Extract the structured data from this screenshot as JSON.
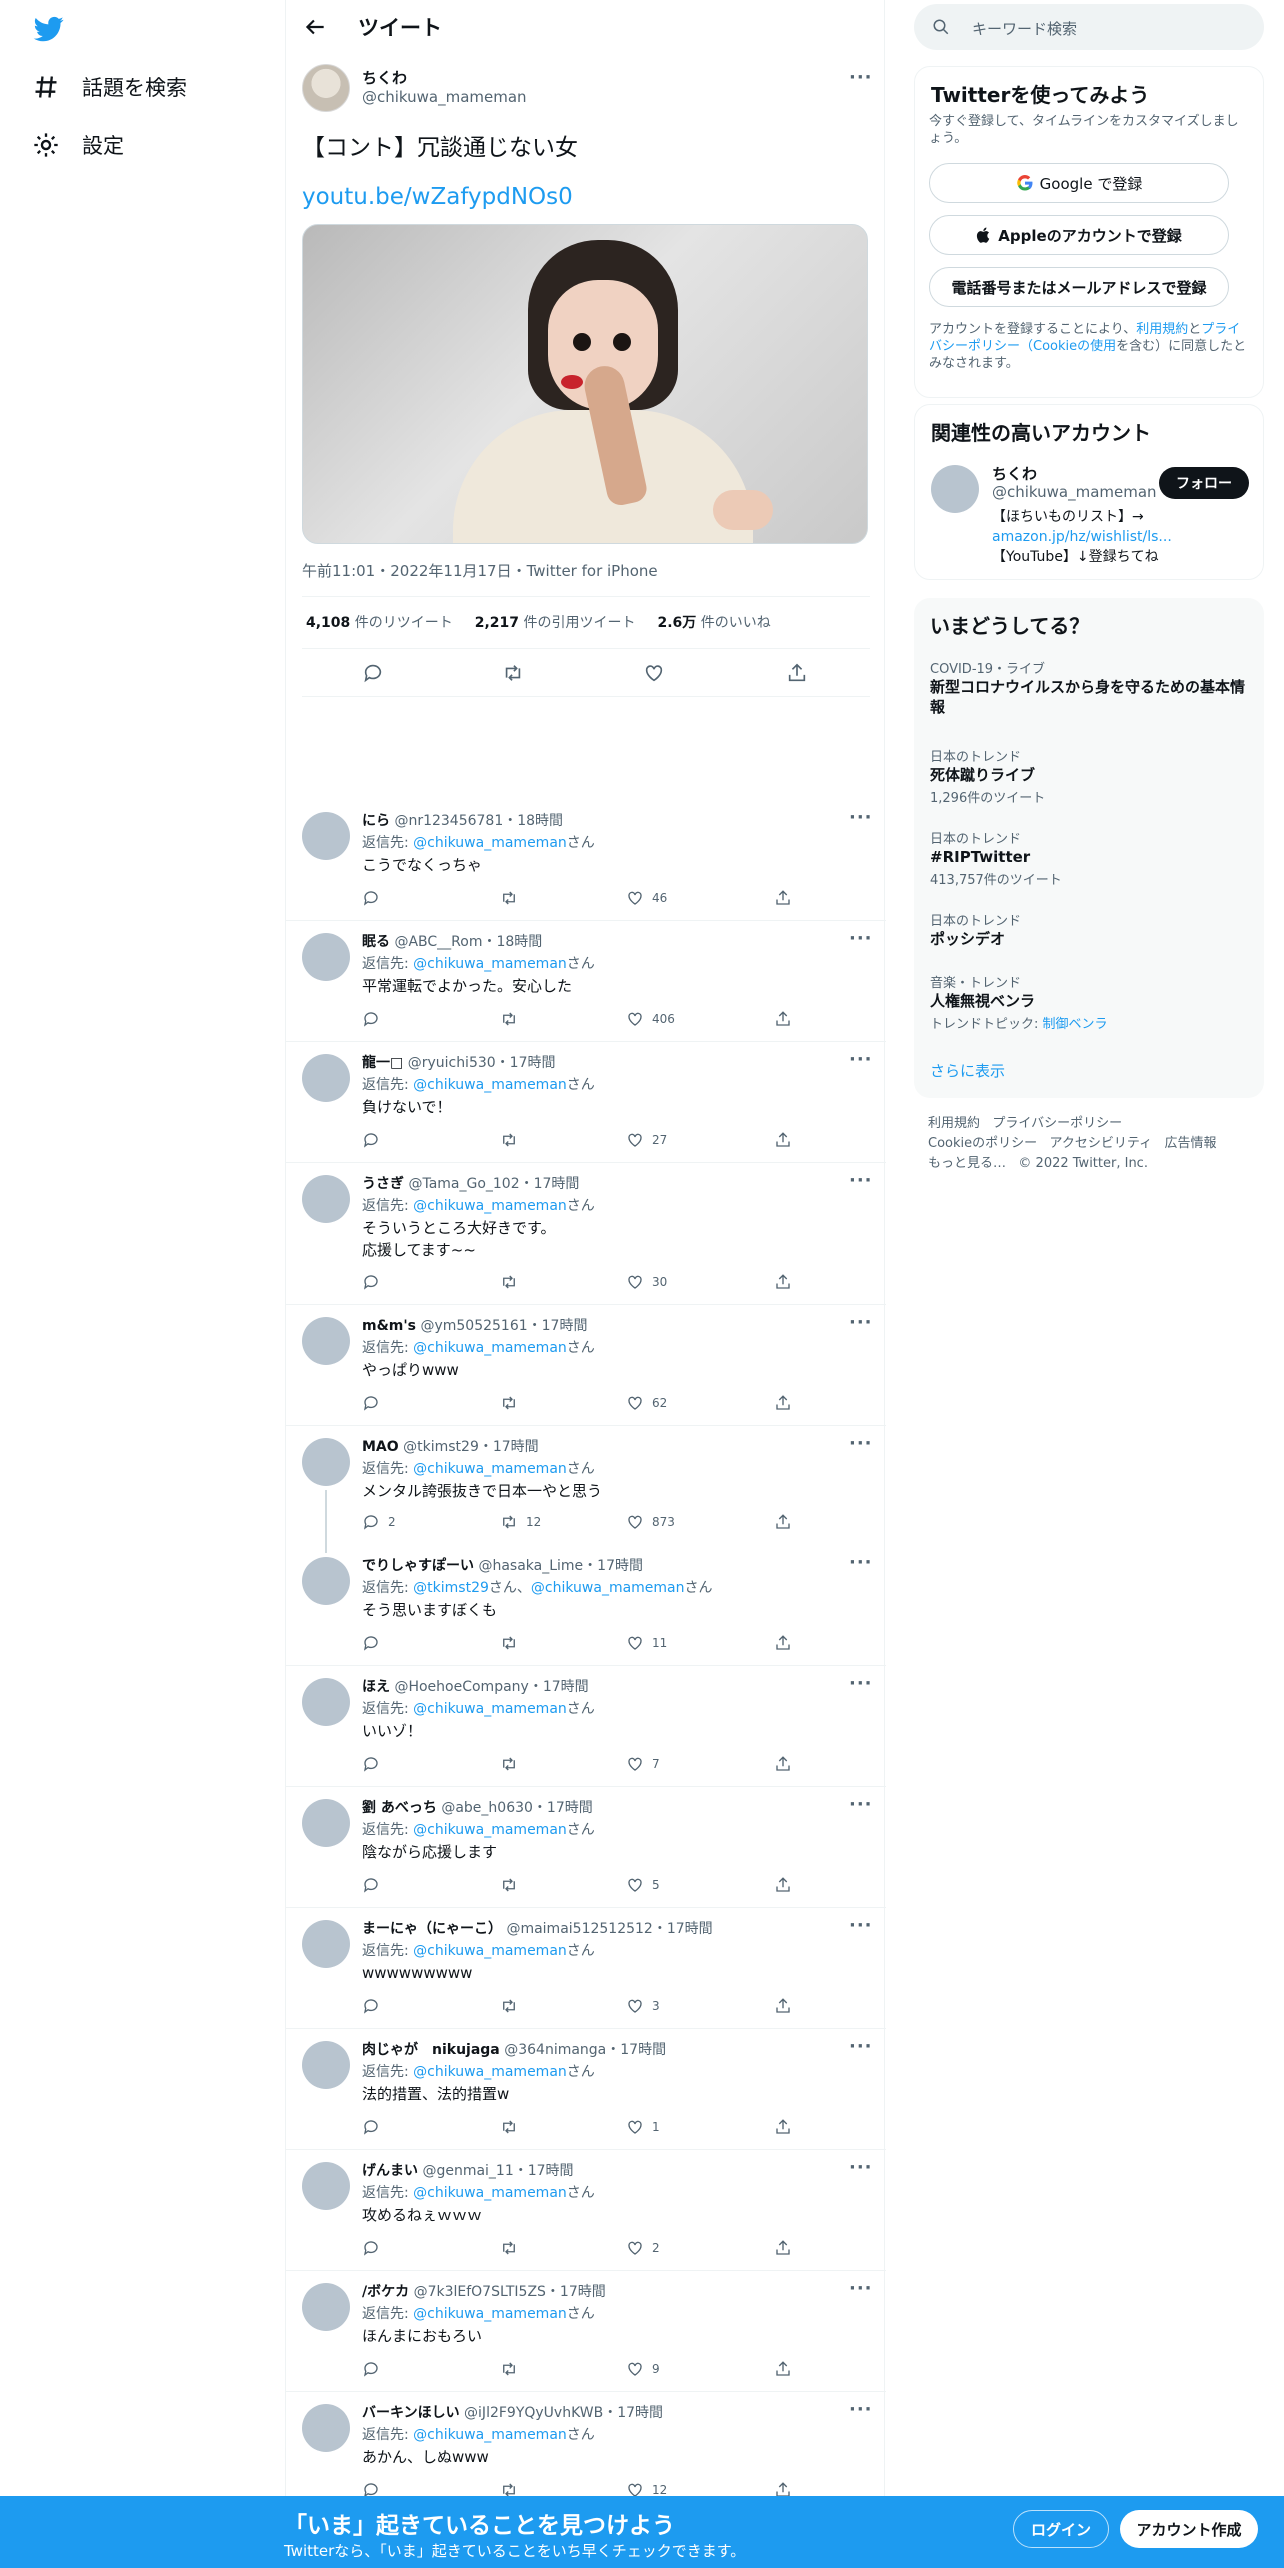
{
  "nav": {
    "explore_label": "話題を検索",
    "settings_label": "設定"
  },
  "header": {
    "title": "ツイート"
  },
  "tweet": {
    "name": "ちくわ",
    "handle": "@chikuwa_mameman",
    "text": "【コント】冗談通じない女",
    "link": "youtu.be/wZafypdNOs0",
    "meta": "午前11:01・2022年11月17日・Twitter for iPhone",
    "stats": {
      "retweets_num": "4,108",
      "retweets_label": "件のリツイート",
      "quotes_num": "2,217",
      "quotes_label": "件の引用ツイート",
      "likes_num": "2.6万",
      "likes_label": "件のいいね"
    }
  },
  "replies": [
    {
      "name": "にら",
      "meta": "@nr123456781・18時間",
      "rto_prefix": "返信先: ",
      "rto": "@chikuwa_mameman",
      "rto_suffix": "さん",
      "lines": [
        "こうでなくっちゃ"
      ],
      "replies": "",
      "retweets": "",
      "likes": "46"
    },
    {
      "name": "眠る",
      "meta": "@ABC__Rom・18時間",
      "rto_prefix": "返信先: ",
      "rto": "@chikuwa_mameman",
      "rto_suffix": "さん",
      "lines": [
        "平常運転でよかった。安心した"
      ],
      "replies": "",
      "retweets": "",
      "likes": "406"
    },
    {
      "name": "龍一□",
      "meta": "@ryuichi530・17時間",
      "rto_prefix": "返信先: ",
      "rto": "@chikuwa_mameman",
      "rto_suffix": "さん",
      "lines": [
        "負けないで！"
      ],
      "replies": "",
      "retweets": "",
      "likes": "27"
    },
    {
      "name": "うさぎ",
      "meta": "@Tama_Go_102・17時間",
      "rto_prefix": "返信先: ",
      "rto": "@chikuwa_mameman",
      "rto_suffix": "さん",
      "lines": [
        "そういうところ大好きです。",
        "応援してます~~"
      ],
      "replies": "",
      "retweets": "",
      "likes": "30"
    },
    {
      "name": "m&m's",
      "meta": "@ym50525161・17時間",
      "rto_prefix": "返信先: ",
      "rto": "@chikuwa_mameman",
      "rto_suffix": "さん",
      "lines": [
        "やっぱりwww"
      ],
      "replies": "",
      "retweets": "",
      "likes": "62"
    },
    {
      "name": "MAO",
      "meta": "@tkimst29・17時間",
      "rto_prefix": "返信先: ",
      "rto": "@chikuwa_mameman",
      "rto_suffix": "さん",
      "lines": [
        "メンタル誇張抜きで日本一やと思う"
      ],
      "replies": "2",
      "retweets": "12",
      "likes": "873"
    },
    {
      "name": "でりしゃすぽーい",
      "meta": "@hasaka_Lime・17時間",
      "rto_prefix": "返信先: ",
      "rto": "@tkimst29",
      "rto_mid": "さん、",
      "rto2": "@chikuwa_mameman",
      "rto_suffix": "さん",
      "lines": [
        "そう思いますぼくも"
      ],
      "replies": "",
      "retweets": "",
      "likes": "11"
    },
    {
      "name": "ほえ",
      "meta": "@HoehoeCompany・17時間",
      "rto_prefix": "返信先: ",
      "rto": "@chikuwa_mameman",
      "rto_suffix": "さん",
      "lines": [
        "いいゾ！"
      ],
      "replies": "",
      "retweets": "",
      "likes": "7"
    },
    {
      "name": "劉 あべっち",
      "meta": "@abe_h0630・17時間",
      "rto_prefix": "返信先: ",
      "rto": "@chikuwa_mameman",
      "rto_suffix": "さん",
      "lines": [
        "陰ながら応援します"
      ],
      "replies": "",
      "retweets": "",
      "likes": "5"
    },
    {
      "name": "まーにゃ（にゃーこ）",
      "meta": "@maimai512512512・17時間",
      "rto_prefix": "返信先: ",
      "rto": "@chikuwa_mameman",
      "rto_suffix": "さん",
      "lines": [
        "wwwwwwwww"
      ],
      "replies": "",
      "retweets": "",
      "likes": "3"
    },
    {
      "name": "肉じゃが　nikujaga",
      "meta": "@364nimanga・17時間",
      "rto_prefix": "返信先: ",
      "rto": "@chikuwa_mameman",
      "rto_suffix": "さん",
      "lines": [
        "法的措置、法的措置w"
      ],
      "replies": "",
      "retweets": "",
      "likes": "1"
    },
    {
      "name": "げんまい",
      "meta": "@genmai_11・17時間",
      "rto_prefix": "返信先: ",
      "rto": "@chikuwa_mameman",
      "rto_suffix": "さん",
      "lines": [
        "攻めるねぇｗｗｗ"
      ],
      "replies": "",
      "retweets": "",
      "likes": "2"
    },
    {
      "name": "/ボケカ",
      "meta": "@7k3lEfO7SLTI5ZS・17時間",
      "rto_prefix": "返信先: ",
      "rto": "@chikuwa_mameman",
      "rto_suffix": "さん",
      "lines": [
        "ほんまにおもろい"
      ],
      "replies": "",
      "retweets": "",
      "likes": "9"
    },
    {
      "name": "バーキンほしい",
      "meta": "@iJl2F9YQyUvhKWB・17時間",
      "rto_prefix": "返信先: ",
      "rto": "@chikuwa_mameman",
      "rto_suffix": "さん",
      "lines": [
        "あかん、しぬwww"
      ],
      "replies": "",
      "retweets": "",
      "likes": "12"
    }
  ],
  "search": {
    "placeholder": "キーワード検索"
  },
  "signup": {
    "title": "Twitterを使ってみよう",
    "subtitle": "今すぐ登録して、タイムラインをカスタマイズしましょう。",
    "google": "Google で登録",
    "apple": "Appleのアカウントで登録",
    "phone": "電話番号またはメールアドレスで登録",
    "terms_1": "アカウントを登録することにより、",
    "terms_link1": "利用規約",
    "terms_2": "と",
    "terms_link2": "プライバシーポリシー（Cookieの使用",
    "terms_3": "を含む）に同意したとみなされます。"
  },
  "related": {
    "title": "関連性の高いアカウント",
    "name": "ちくわ",
    "handle": "@chikuwa_mameman",
    "follow": "フォロー",
    "bio1": "【ほちいものリスト】→",
    "bio_link": "amazon.jp/hz/wishlist/ls...",
    "bio2": "【YouTube】↓登録ちてね"
  },
  "trends": {
    "title": "いまどうしてる？",
    "items": [
      {
        "ctx": "COVID-19・ライブ",
        "title": "新型コロナウイルスから身を守るための基本情報",
        "count": ""
      },
      {
        "ctx": "日本のトレンド",
        "title": "死体蹴りライブ",
        "count": "1,296件のツイート"
      },
      {
        "ctx": "日本のトレンド",
        "title": "#RIPTwitter",
        "count": "413,757件のツイート"
      },
      {
        "ctx": "日本のトレンド",
        "title": "ポッシデオ",
        "count": ""
      },
      {
        "ctx": "音楽・トレンド",
        "title": "人権無視ベンラ",
        "count": ""
      }
    ],
    "topic_prefix": "トレンドトピック: ",
    "topic_link": "制御ベンラ",
    "show_more": "さらに表示"
  },
  "footer": {
    "l1": "利用規約",
    "l2": "プライバシーポリシー",
    "l3": "Cookieのポリシー",
    "l4": "アクセシビリティ",
    "l5": "広告情報",
    "more": "もっと見る…",
    "copy": "© 2022 Twitter, Inc."
  },
  "bottom": {
    "title": "「いま」起きていることを見つけよう",
    "subtitle": "Twitterなら、「いま」起きていることをいち早くチェックできます。",
    "login": "ログイン",
    "signup": "アカウント作成"
  },
  "colors": {
    "accent": "#1d9bf0",
    "text": "#0f1419",
    "muted": "#536471"
  }
}
